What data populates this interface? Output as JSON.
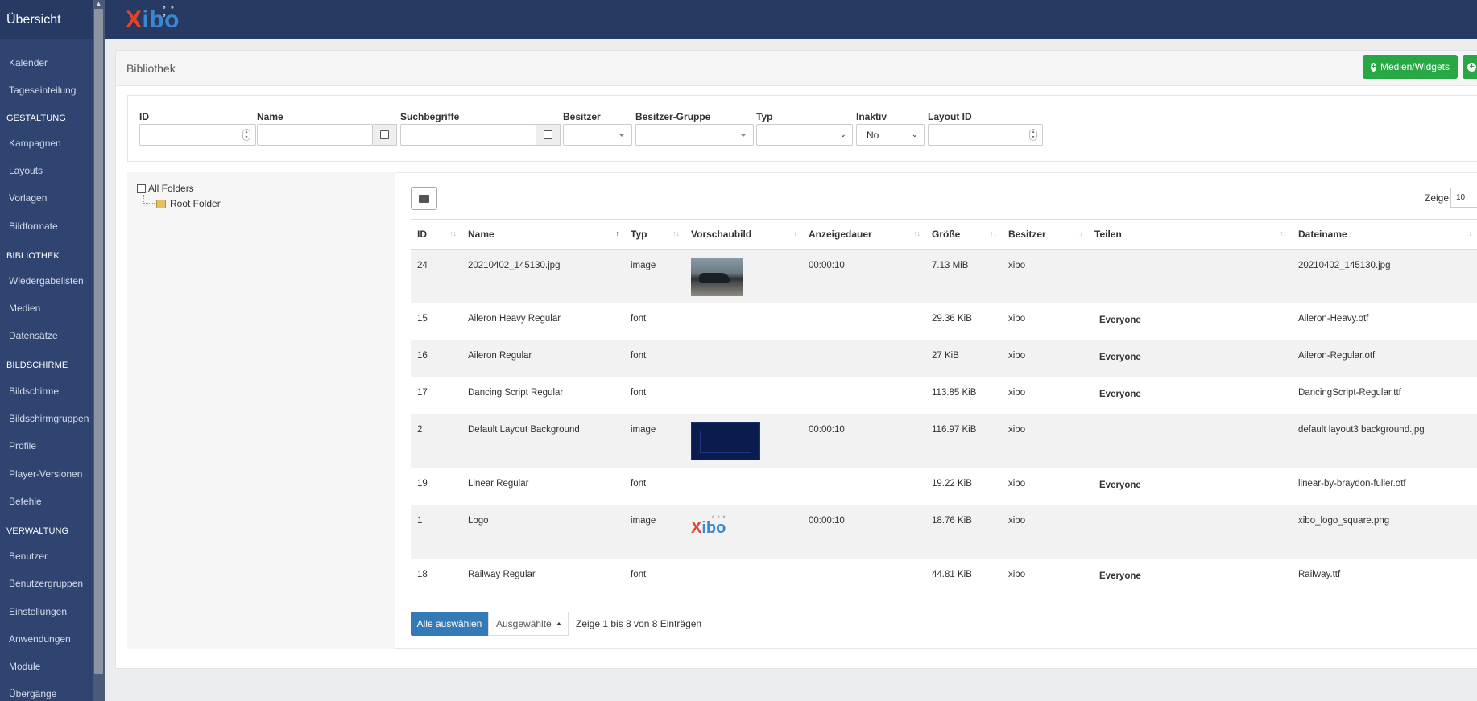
{
  "sidebar": {
    "brand": "Übersicht",
    "items": [
      {
        "label": "Kalender",
        "type": "item"
      },
      {
        "label": "Tageseinteilung",
        "type": "item"
      },
      {
        "label": "GESTALTUNG",
        "type": "section"
      },
      {
        "label": "Kampagnen",
        "type": "item"
      },
      {
        "label": "Layouts",
        "type": "item"
      },
      {
        "label": "Vorlagen",
        "type": "item"
      },
      {
        "label": "Bildformate",
        "type": "item"
      },
      {
        "label": "BIBLIOTHEK",
        "type": "section"
      },
      {
        "label": "Wiedergabelisten",
        "type": "item"
      },
      {
        "label": "Medien",
        "type": "item"
      },
      {
        "label": "Datensätze",
        "type": "item"
      },
      {
        "label": "BILDSCHIRME",
        "type": "section"
      },
      {
        "label": "Bildschirme",
        "type": "item"
      },
      {
        "label": "Bildschirmgruppen",
        "type": "item"
      },
      {
        "label": "Profile",
        "type": "item"
      },
      {
        "label": "Player-Versionen",
        "type": "item"
      },
      {
        "label": "Befehle",
        "type": "item"
      },
      {
        "label": "VERWALTUNG",
        "type": "section"
      },
      {
        "label": "Benutzer",
        "type": "item"
      },
      {
        "label": "Benutzergruppen",
        "type": "item"
      },
      {
        "label": "Einstellungen",
        "type": "item"
      },
      {
        "label": "Anwendungen",
        "type": "item"
      },
      {
        "label": "Module",
        "type": "item"
      },
      {
        "label": "Übergänge",
        "type": "item"
      }
    ]
  },
  "header": {
    "logo_x": "X",
    "logo_rest": "ibo",
    "logo_dots": "° ° °"
  },
  "page": {
    "title": "Bibliothek",
    "add_media_button": "Medien/Widgets"
  },
  "filters": {
    "id_label": "ID",
    "name_label": "Name",
    "keywords_label": "Suchbegriffe",
    "owner_label": "Besitzer",
    "owner_group_label": "Besitzer-Gruppe",
    "type_label": "Typ",
    "retired_label": "Inaktiv",
    "retired_value": "No",
    "layout_id_label": "Layout ID"
  },
  "folders": {
    "all": "All Folders",
    "root": "Root Folder"
  },
  "table": {
    "page_size_label": "Zeige",
    "page_size_value": "10",
    "headers": {
      "id": "ID",
      "name": "Name",
      "type": "Typ",
      "thumb": "Vorschaubild",
      "duration": "Anzeigedauer",
      "size": "Größe",
      "owner": "Besitzer",
      "share": "Teilen",
      "file": "Dateiname"
    },
    "rows": [
      {
        "id": "24",
        "name": "20210402_145130.jpg",
        "type": "image",
        "thumb": "car",
        "duration": "00:00:10",
        "size": "7.13 MiB",
        "owner": "xibo",
        "share": "",
        "file": "20210402_145130.jpg"
      },
      {
        "id": "15",
        "name": "Aileron Heavy Regular",
        "type": "font",
        "thumb": "",
        "duration": "",
        "size": "29.36 KiB",
        "owner": "xibo",
        "share": "Everyone",
        "file": "Aileron-Heavy.otf"
      },
      {
        "id": "16",
        "name": "Aileron Regular",
        "type": "font",
        "thumb": "",
        "duration": "",
        "size": "27 KiB",
        "owner": "xibo",
        "share": "Everyone",
        "file": "Aileron-Regular.otf"
      },
      {
        "id": "17",
        "name": "Dancing Script Regular",
        "type": "font",
        "thumb": "",
        "duration": "",
        "size": "113.85 KiB",
        "owner": "xibo",
        "share": "Everyone",
        "file": "DancingScript-Regular.ttf"
      },
      {
        "id": "2",
        "name": "Default Layout Background",
        "type": "image",
        "thumb": "bg",
        "duration": "00:00:10",
        "size": "116.97 KiB",
        "owner": "xibo",
        "share": "",
        "file": "default layout3 background.jpg"
      },
      {
        "id": "19",
        "name": "Linear Regular",
        "type": "font",
        "thumb": "",
        "duration": "",
        "size": "19.22 KiB",
        "owner": "xibo",
        "share": "Everyone",
        "file": "linear-by-braydon-fuller.otf"
      },
      {
        "id": "1",
        "name": "Logo",
        "type": "image",
        "thumb": "logo",
        "duration": "00:00:10",
        "size": "18.76 KiB",
        "owner": "xibo",
        "share": "",
        "file": "xibo_logo_square.png"
      },
      {
        "id": "18",
        "name": "Railway Regular",
        "type": "font",
        "thumb": "",
        "duration": "",
        "size": "44.81 KiB",
        "owner": "xibo",
        "share": "Everyone",
        "file": "Railway.ttf"
      }
    ]
  },
  "footer": {
    "select_all": "Alle auswählen",
    "selected": "Ausgewählte",
    "info": "Zeige 1 bis 8 von 8 Einträgen"
  }
}
